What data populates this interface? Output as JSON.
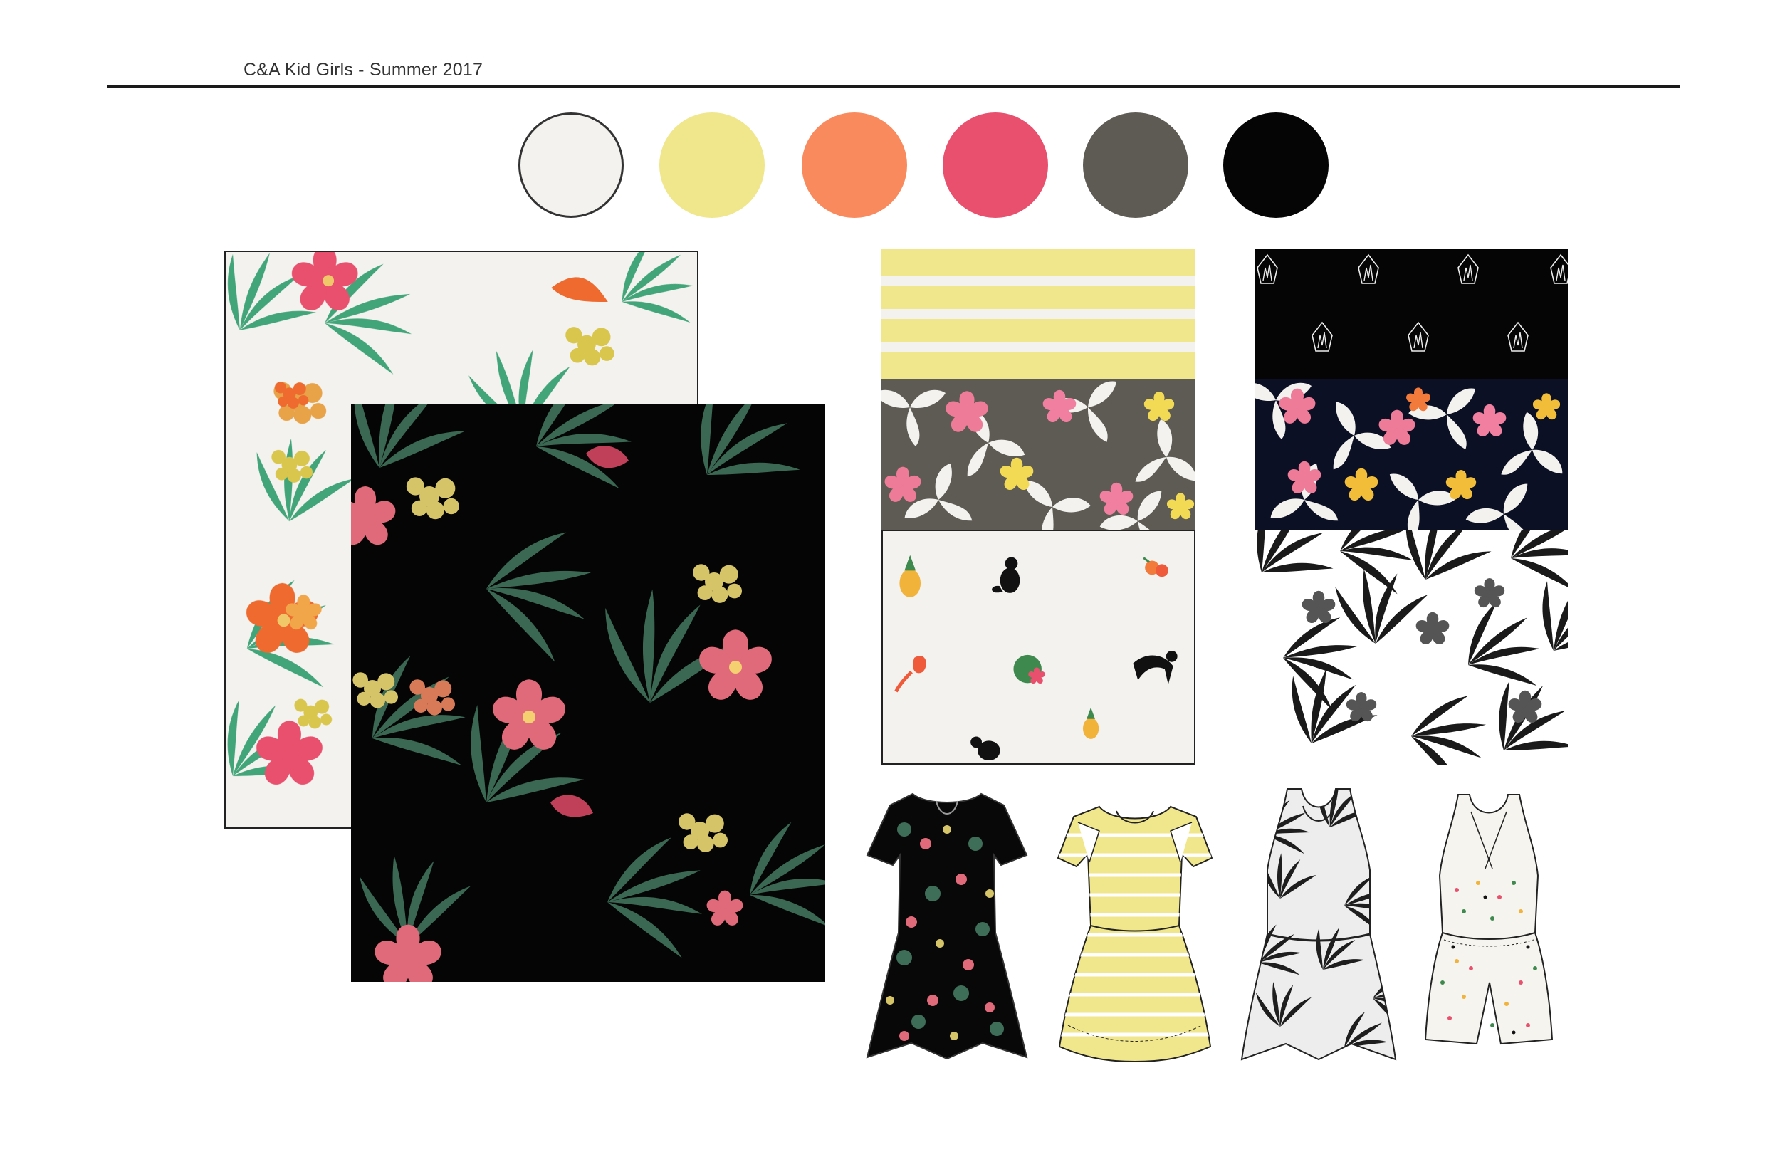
{
  "header": {
    "title": "C&A Kid Girls - Summer 2017"
  },
  "palette": [
    {
      "name": "off-white",
      "hex": "#F3F2EE"
    },
    {
      "name": "pale-yellow",
      "hex": "#F0E68B"
    },
    {
      "name": "coral",
      "hex": "#F98A5E"
    },
    {
      "name": "pink",
      "hex": "#E8506E"
    },
    {
      "name": "olive-grey",
      "hex": "#5D5B53"
    },
    {
      "name": "black",
      "hex": "#050505"
    }
  ],
  "prints": [
    {
      "name": "tropical-floral-on-cream",
      "background": "#F3F2EE"
    },
    {
      "name": "tropical-floral-on-black",
      "background": "#050505"
    },
    {
      "name": "yellow-stripe",
      "background": "#F0E68B"
    },
    {
      "name": "painted-floral-on-grey",
      "background": "#5D5B53"
    },
    {
      "name": "conversational-icons-on-cream",
      "background": "#F3F2EE"
    },
    {
      "name": "crystal-icons-on-black",
      "background": "#050505"
    },
    {
      "name": "floral-on-navy",
      "background": "#0C1024"
    },
    {
      "name": "black-white-tropical-leaf",
      "background": "#FFFFFF"
    }
  ],
  "garments": [
    {
      "name": "dress-black-floral-cap-sleeve"
    },
    {
      "name": "dress-yellow-stripe-cold-shoulder"
    },
    {
      "name": "dress-bw-leaf-sleeveless"
    },
    {
      "name": "romper-cream-icons"
    }
  ]
}
